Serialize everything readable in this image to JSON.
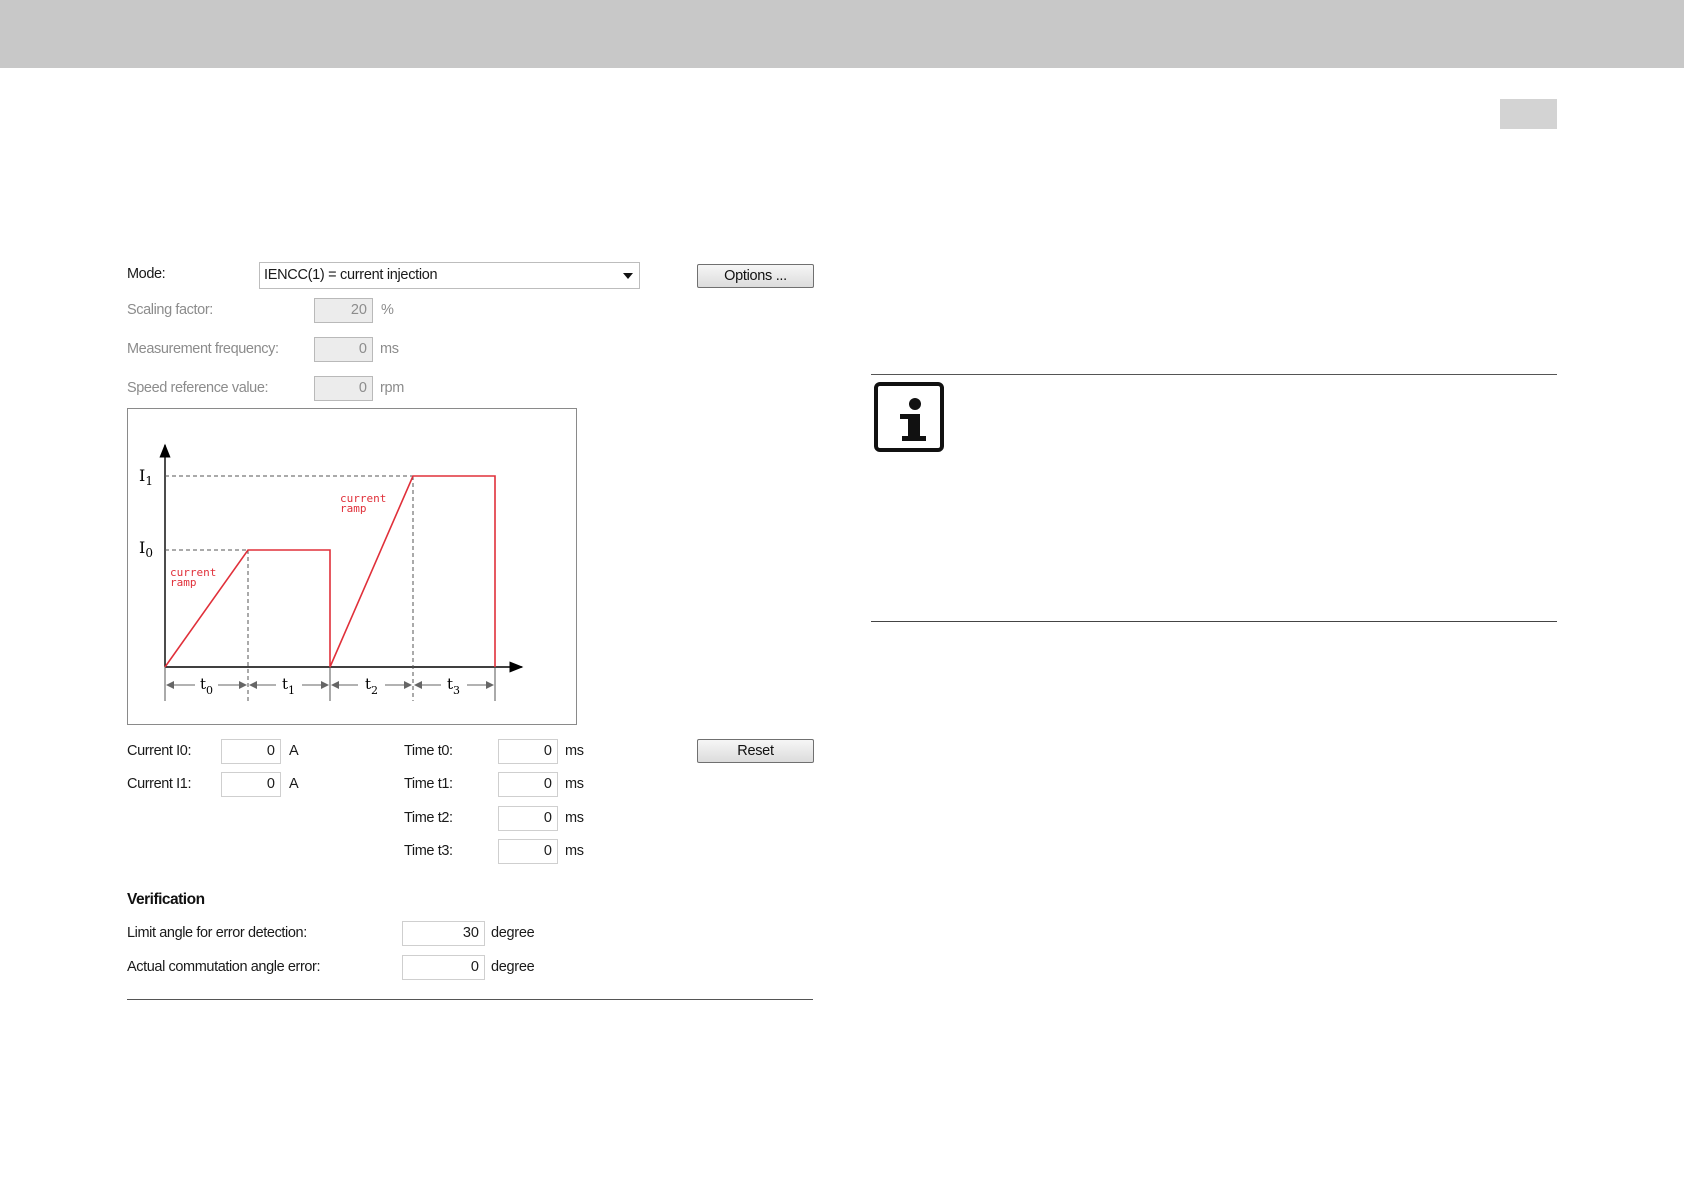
{
  "form": {
    "mode_label": "Mode:",
    "mode_value": "IENCC(1) = current injection",
    "options_button": "Options ...",
    "scaling": {
      "label": "Scaling factor:",
      "value": "20",
      "unit": "%"
    },
    "measurement": {
      "label": "Measurement frequency:",
      "value": "0",
      "unit": "ms"
    },
    "speed": {
      "label": "Speed reference value:",
      "value": "0",
      "unit": "rpm"
    },
    "current_i0": {
      "label": "Current I0:",
      "value": "0",
      "unit": "A"
    },
    "current_i1": {
      "label": "Current I1:",
      "value": "0",
      "unit": "A"
    },
    "time_t0": {
      "label": "Time t0:",
      "value": "0",
      "unit": "ms"
    },
    "time_t1": {
      "label": "Time t1:",
      "value": "0",
      "unit": "ms"
    },
    "time_t2": {
      "label": "Time t2:",
      "value": "0",
      "unit": "ms"
    },
    "time_t3": {
      "label": "Time t3:",
      "value": "0",
      "unit": "ms"
    },
    "reset_button": "Reset"
  },
  "diagram": {
    "y_label_i1": "I",
    "y_label_i1_sub": "1",
    "y_label_i0": "I",
    "y_label_i0_sub": "0",
    "ramp_label_line1": "current",
    "ramp_label_line2": "ramp",
    "t_main": "t",
    "t0_sub": "0",
    "t1_sub": "1",
    "t2_sub": "2",
    "t3_sub": "3",
    "line_color": "#e0303a"
  },
  "verification": {
    "title": "Verification",
    "limit": {
      "label": "Limit angle for error detection:",
      "value": "30",
      "unit": "degree"
    },
    "actual": {
      "label": "Actual commutation angle error:",
      "value": "0",
      "unit": "degree"
    }
  },
  "icons": {
    "info": "info-icon"
  }
}
